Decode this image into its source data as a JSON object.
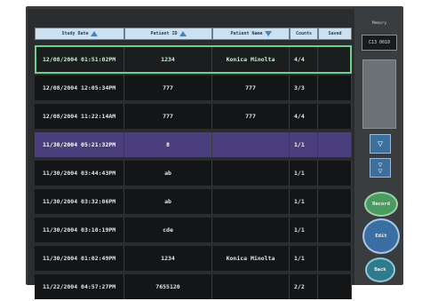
{
  "table": {
    "headers": [
      "Study Date",
      "Patient ID",
      "Patient Name",
      "Counts",
      "Saved"
    ],
    "rows": [
      {
        "date": "12/08/2004 01:51:02PM",
        "patient_id": "1234",
        "patient_name": "Konica Minolta",
        "count": "4/4",
        "saved": ""
      },
      {
        "date": "12/08/2004 12:05:34PM",
        "patient_id": "777",
        "patient_name": "777",
        "count": "3/3",
        "saved": ""
      },
      {
        "date": "12/08/2004 11:22:14AM",
        "patient_id": "777",
        "patient_name": "777",
        "count": "4/4",
        "saved": ""
      },
      {
        "date": "11/30/2004 05:21:32PM",
        "patient_id": "8",
        "patient_name": "",
        "count": "1/1",
        "saved": ""
      },
      {
        "date": "11/30/2004 03:44:43PM",
        "patient_id": "ab",
        "patient_name": "",
        "count": "1/1",
        "saved": ""
      },
      {
        "date": "11/30/2004 03:32:06PM",
        "patient_id": "ab",
        "patient_name": "",
        "count": "1/1",
        "saved": ""
      },
      {
        "date": "11/30/2004 03:10:19PM",
        "patient_id": "cde",
        "patient_name": "",
        "count": "1/1",
        "saved": ""
      },
      {
        "date": "11/30/2004 01:02:49PM",
        "patient_id": "1234",
        "patient_name": "Konica Minolta",
        "count": "1/1",
        "saved": ""
      },
      {
        "date": "11/22/2004 04:57:27PM",
        "patient_id": "7655120",
        "patient_name": "",
        "count": "2/2",
        "saved": ""
      }
    ]
  },
  "side": {
    "label": "Memory",
    "box_text": "C13 0010",
    "record_label": "Record",
    "edit_label": "Edit",
    "back_label": "Back"
  },
  "colors": {
    "selected_outline": "#6fcf8e",
    "highlight_row": "#4a3f7c",
    "header_bg": "#cde0f0"
  }
}
